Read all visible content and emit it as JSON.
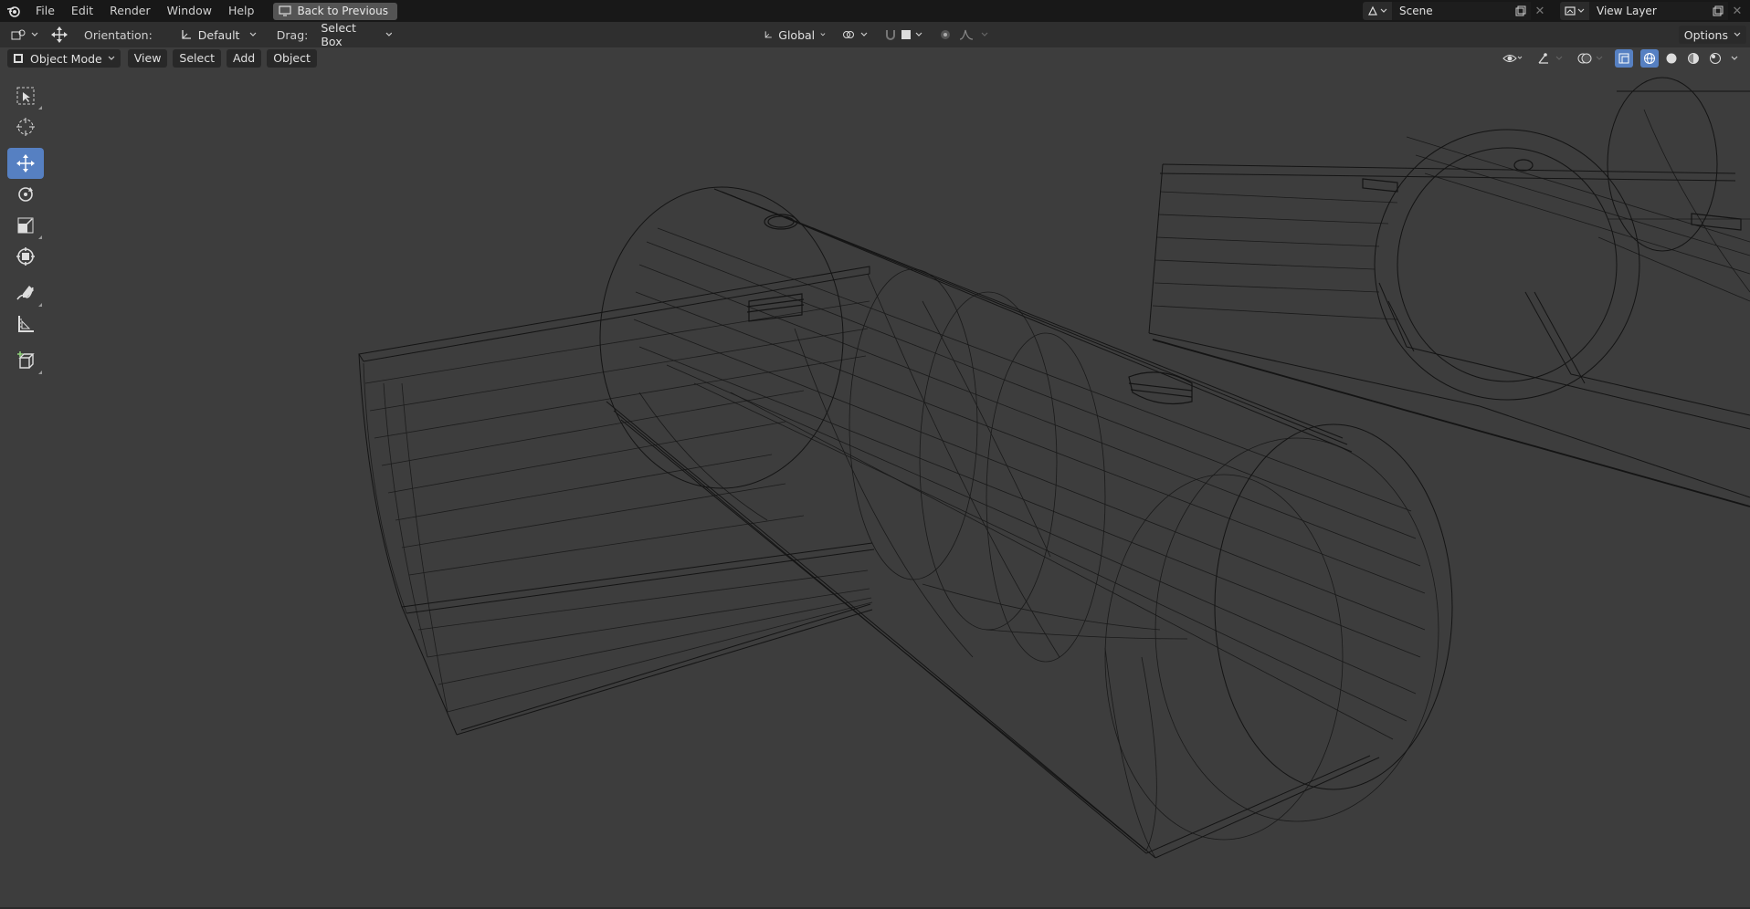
{
  "topbar": {
    "menu": [
      "File",
      "Edit",
      "Render",
      "Window",
      "Help"
    ],
    "back_label": "Back to Previous",
    "scene_name": "Scene",
    "view_layer": "View Layer"
  },
  "toolheader": {
    "orientation_label": "Orientation:",
    "orientation_value": "Default",
    "drag_label": "Drag:",
    "drag_value": "Select Box",
    "transform_orientation": "Global",
    "options_label": "Options"
  },
  "viewport_header": {
    "mode": "Object Mode",
    "menus": [
      "View",
      "Select",
      "Add",
      "Object"
    ]
  },
  "tools": [
    "select-box-tool",
    "cursor-tool",
    "move-tool",
    "rotate-tool",
    "scale-tool",
    "transform-tool",
    "annotate-tool",
    "measure-tool",
    "add-cube-tool"
  ],
  "active_tool": "move-tool",
  "colors": {
    "accent": "#5680c2",
    "viewport_bg": "#3d3d3d",
    "wire": "#111111"
  }
}
